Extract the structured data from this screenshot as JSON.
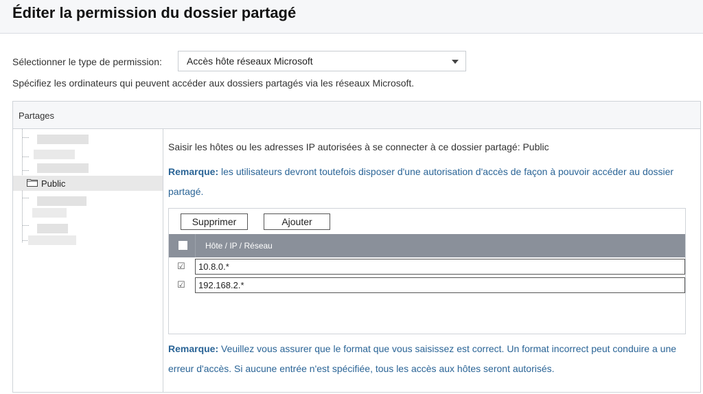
{
  "header": {
    "title": "Éditer la permission du dossier partagé"
  },
  "permission": {
    "label": "Sélectionner le type de permission:",
    "selected": "Accès hôte réseaux Microsoft"
  },
  "description": "Spécifiez les ordinateurs qui peuvent accéder aux dossiers partagés via les réseaux Microsoft.",
  "panel": {
    "header": "Partages",
    "tree": {
      "selected_label": "Public"
    },
    "hint": "Saisir les hôtes ou les adresses IP autorisées à se connecter à ce dossier partagé: Public",
    "remark1_prefix": "Remarque:",
    "remark1_text": " les utilisateurs devront toutefois disposer d'une autorisation d'accès de façon à pouvoir accéder au dossier partagé.",
    "buttons": {
      "delete": "Supprimer",
      "add": "Ajouter"
    },
    "table": {
      "column": "Hôte / IP / Réseau",
      "rows": [
        {
          "checked": true,
          "value": "10.8.0.*"
        },
        {
          "checked": true,
          "value": "192.168.2.*"
        }
      ]
    },
    "remark2_prefix": "Remarque:",
    "remark2_text": " Veuillez vous assurer que le format que vous saisissez est correct. Un format incorrect peut conduire a une erreur d'accès. Si aucune entrée n'est spécifiée, tous les accès aux hôtes seront autorisés."
  },
  "colors": {
    "accent_text": "#2a6496",
    "table_header": "#8a909a",
    "header_bg": "#f6f7f9"
  },
  "icons": {
    "dropdown": "chevron-down-icon",
    "folder": "folder-icon",
    "checkbox": "checkbox-icon"
  }
}
